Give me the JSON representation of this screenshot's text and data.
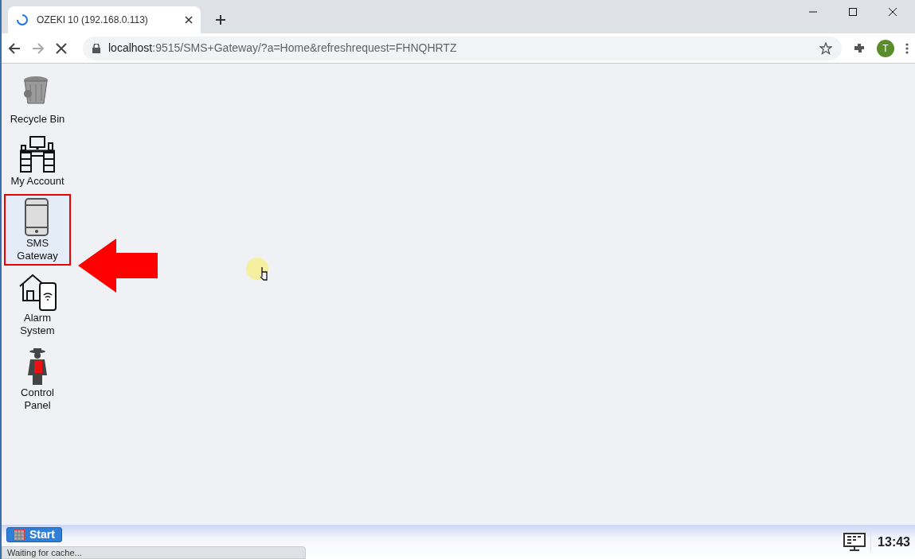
{
  "browser": {
    "tab_title": "OZEKI 10 (192.168.0.113)",
    "loading": true,
    "url_host": "localhost",
    "url_rest": ":9515/SMS+Gateway/?a=Home&refreshrequest=FHNQHRTZ",
    "profile_initial": "T"
  },
  "desktop_icons": [
    {
      "kind": "bin",
      "label": "Recycle Bin",
      "selected": false
    },
    {
      "kind": "desk",
      "label": "My Account",
      "selected": false
    },
    {
      "kind": "sms",
      "label": "SMS Gateway",
      "selected": true
    },
    {
      "kind": "alarm",
      "label": "Alarm System",
      "selected": false
    },
    {
      "kind": "control",
      "label": "Control Panel",
      "selected": false
    }
  ],
  "taskbar": {
    "start_label": "Start",
    "clock": "13:43"
  },
  "status_bubble": "Waiting for cache..."
}
